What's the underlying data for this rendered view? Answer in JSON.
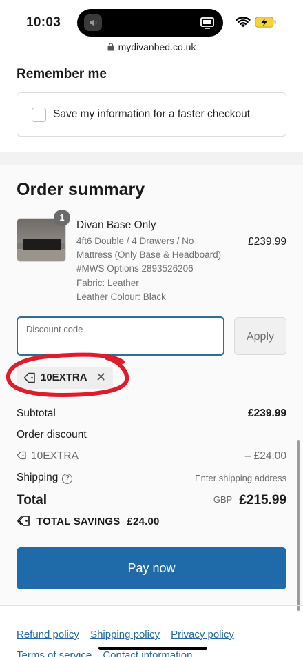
{
  "status_bar": {
    "time": "10:03"
  },
  "browser": {
    "url": "mydivanbed.co.uk"
  },
  "remember_me": {
    "heading": "Remember me",
    "checkbox_label": "Save my information for a faster checkout"
  },
  "order_summary": {
    "heading": "Order summary",
    "product": {
      "quantity": "1",
      "title": "Divan Base Only",
      "variant_lines": [
        "4ft6 Double / 4 Drawers / No",
        "Mattress (Only Base & Headboard)",
        "#MWS Options 2893526206",
        "Fabric: Leather",
        "Leather Colour: Black"
      ],
      "price": "£239.99"
    },
    "discount": {
      "placeholder": "Discount code",
      "apply_label": "Apply",
      "applied_code": "10EXTRA"
    },
    "subtotal": {
      "label": "Subtotal",
      "value": "£239.99"
    },
    "order_discount": {
      "label": "Order discount",
      "code": "10EXTRA",
      "value": "– £24.00"
    },
    "shipping": {
      "label": "Shipping",
      "value": "Enter shipping address"
    },
    "total": {
      "label": "Total",
      "currency": "GBP",
      "value": "£215.99"
    },
    "savings": {
      "label": "TOTAL SAVINGS",
      "value": "£24.00"
    },
    "pay_button": "Pay now"
  },
  "footer": {
    "links": [
      "Refund policy",
      "Shipping policy",
      "Privacy policy",
      "Terms of service",
      "Contact information"
    ]
  },
  "colors": {
    "accent": "#1f6aa8",
    "input_focus": "#2f6f93",
    "annotation_red": "#e01b2a"
  }
}
